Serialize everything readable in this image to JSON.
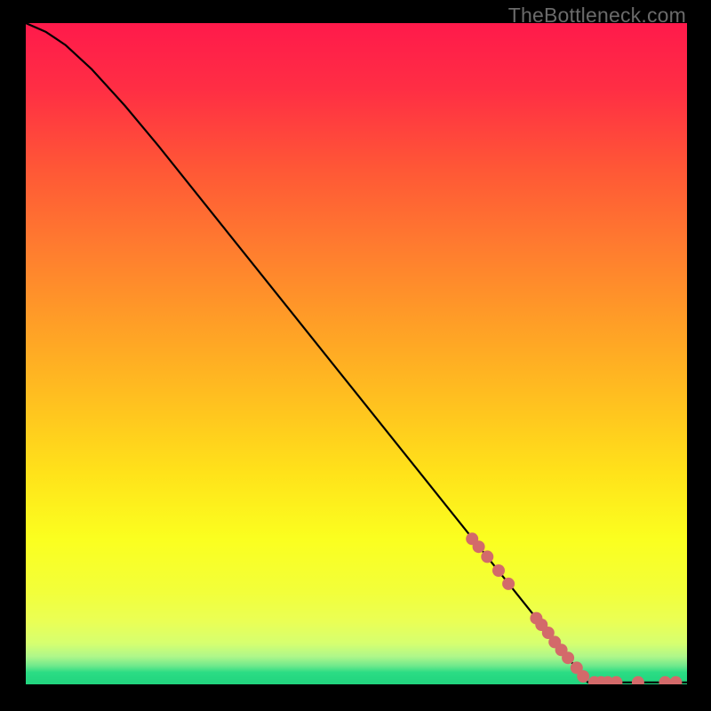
{
  "watermark": "TheBottleneck.com",
  "chart_data": {
    "type": "line",
    "title": "",
    "xlabel": "",
    "ylabel": "",
    "xlim": [
      0,
      100
    ],
    "ylim": [
      0,
      100
    ],
    "background_gradient": {
      "top_color": "#ff1a4b",
      "mid_colors": [
        "#ff7c2f",
        "#ffd21f",
        "#f8ff1f",
        "#d8ff60"
      ],
      "bottom_band": "#2bdc84",
      "bottom_band_start": 97
    },
    "curve": {
      "description": "Monotone decreasing curve starting at top-left, slight convex bend near start, then nearly straight diagonal to lower-right, flattening to a horizontal tail along the bottom.",
      "points": [
        {
          "x": 0.0,
          "y": 100.0
        },
        {
          "x": 3.0,
          "y": 98.7
        },
        {
          "x": 6.0,
          "y": 96.7
        },
        {
          "x": 10.0,
          "y": 93.0
        },
        {
          "x": 15.0,
          "y": 87.5
        },
        {
          "x": 20.0,
          "y": 81.5
        },
        {
          "x": 30.0,
          "y": 69.0
        },
        {
          "x": 40.0,
          "y": 56.5
        },
        {
          "x": 50.0,
          "y": 44.0
        },
        {
          "x": 60.0,
          "y": 31.5
        },
        {
          "x": 70.0,
          "y": 19.0
        },
        {
          "x": 80.0,
          "y": 6.5
        },
        {
          "x": 85.0,
          "y": 0.3
        },
        {
          "x": 90.0,
          "y": 0.3
        },
        {
          "x": 95.0,
          "y": 0.3
        },
        {
          "x": 100.0,
          "y": 0.3
        }
      ]
    },
    "markers": {
      "color": "#d36a6a",
      "radius": 7,
      "points": [
        {
          "x": 67.5,
          "y": 22.0
        },
        {
          "x": 68.5,
          "y": 20.8
        },
        {
          "x": 69.8,
          "y": 19.3
        },
        {
          "x": 71.5,
          "y": 17.2
        },
        {
          "x": 73.0,
          "y": 15.2
        },
        {
          "x": 77.2,
          "y": 10.0
        },
        {
          "x": 78.0,
          "y": 9.0
        },
        {
          "x": 79.0,
          "y": 7.8
        },
        {
          "x": 80.0,
          "y": 6.4
        },
        {
          "x": 81.0,
          "y": 5.2
        },
        {
          "x": 82.0,
          "y": 4.0
        },
        {
          "x": 83.3,
          "y": 2.5
        },
        {
          "x": 84.3,
          "y": 1.2
        },
        {
          "x": 86.0,
          "y": 0.3
        },
        {
          "x": 87.0,
          "y": 0.3
        },
        {
          "x": 88.0,
          "y": 0.3
        },
        {
          "x": 89.3,
          "y": 0.3
        },
        {
          "x": 92.6,
          "y": 0.3
        },
        {
          "x": 96.7,
          "y": 0.3
        },
        {
          "x": 98.3,
          "y": 0.3
        }
      ]
    }
  }
}
